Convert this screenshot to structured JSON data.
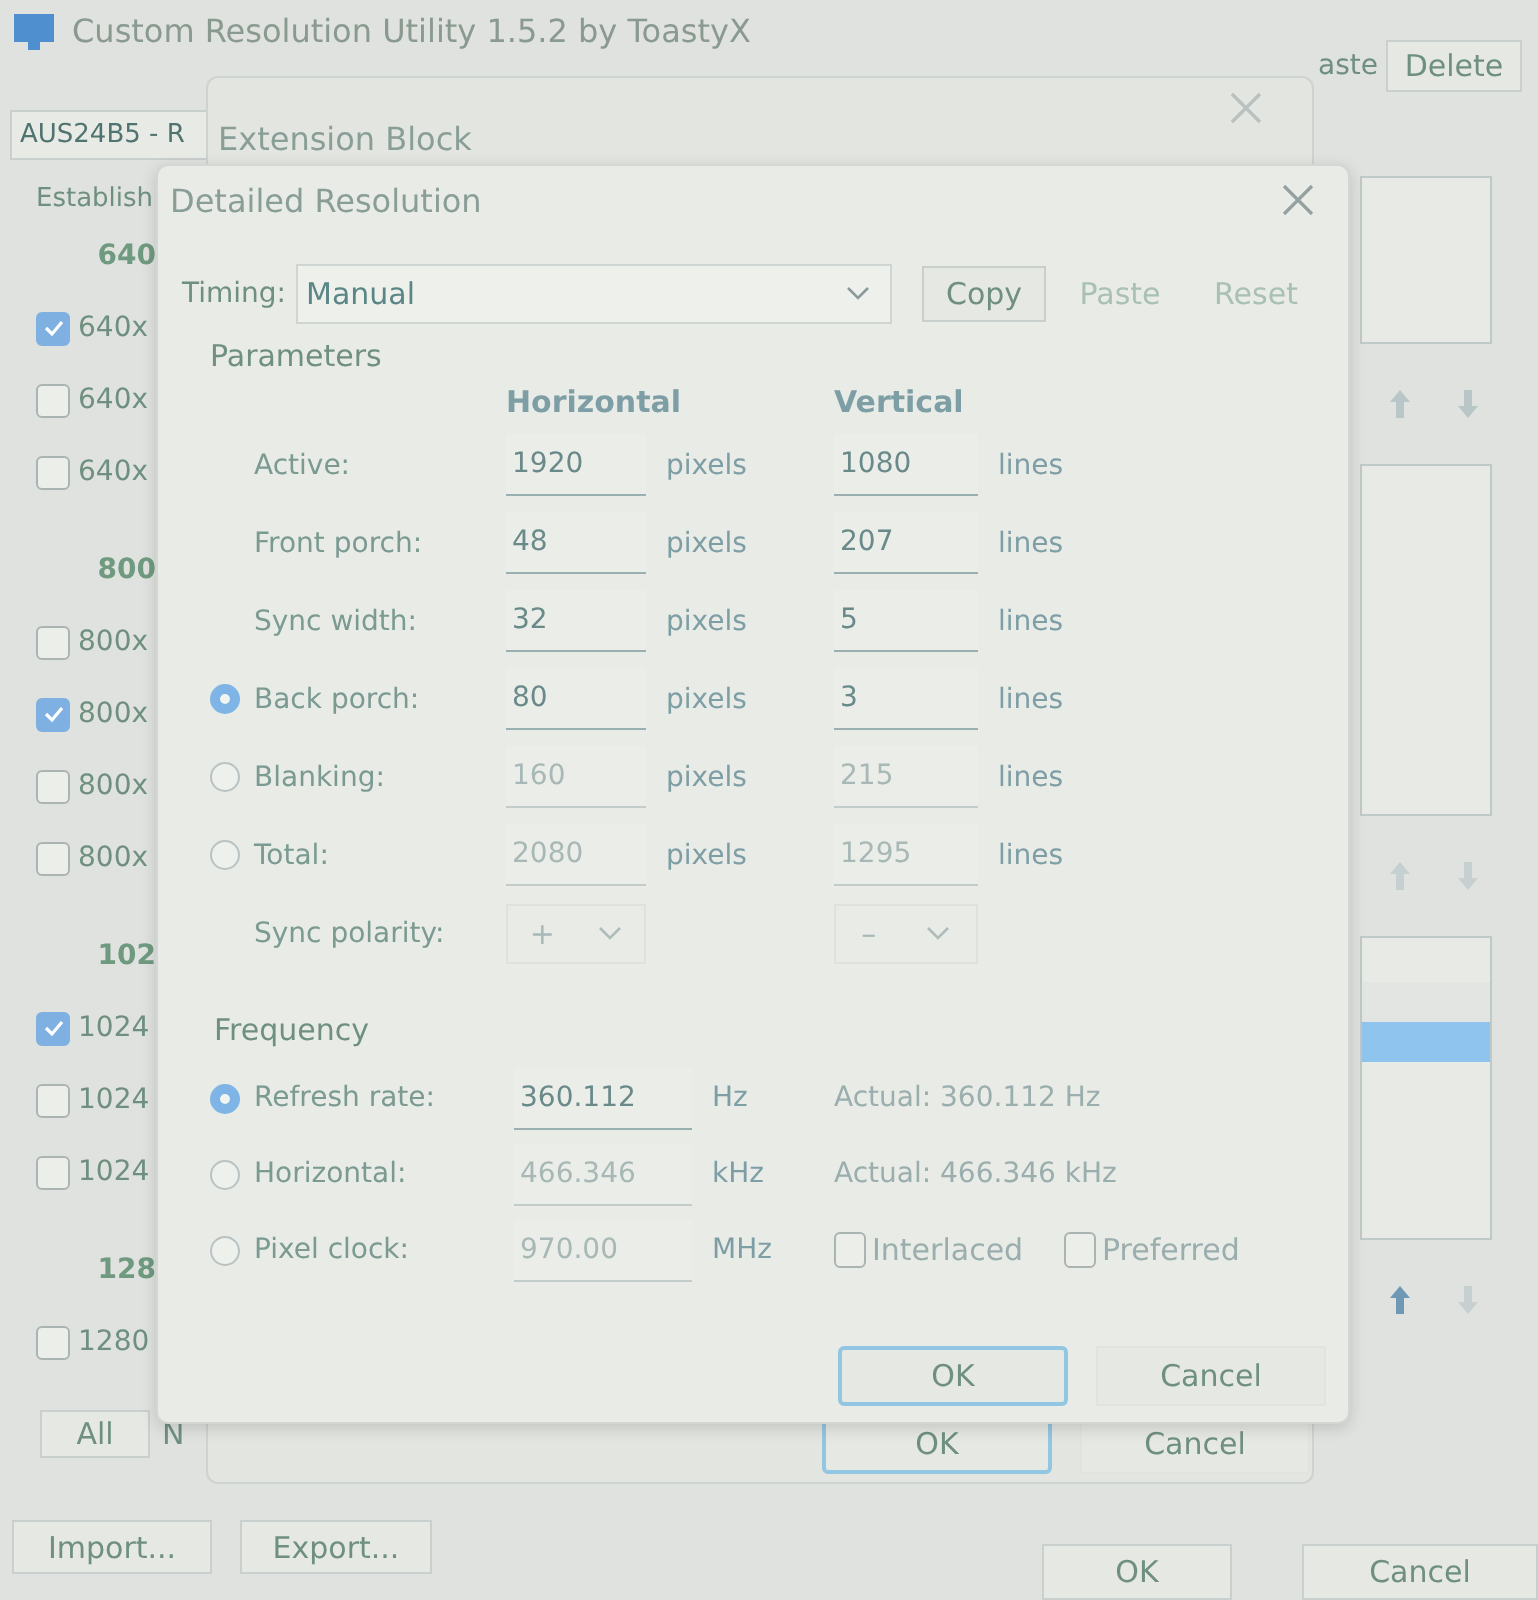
{
  "main_window": {
    "title": "Custom Resolution Utility 1.5.2 by ToastyX",
    "monitor_select": "AUS24B5 - R",
    "top_buttons": [
      "aste",
      "Delete"
    ],
    "established": {
      "label": "Establish",
      "groups": [
        {
          "header": "640",
          "items": [
            {
              "label": "640x",
              "checked": true
            },
            {
              "label": "640x",
              "checked": false
            },
            {
              "label": "640x",
              "checked": false
            }
          ]
        },
        {
          "header": "800",
          "items": [
            {
              "label": "800x",
              "checked": false
            },
            {
              "label": "800x",
              "checked": true
            },
            {
              "label": "800x",
              "checked": false
            },
            {
              "label": "800x",
              "checked": false
            }
          ]
        },
        {
          "header": "102",
          "items": [
            {
              "label": "1024",
              "checked": true
            },
            {
              "label": "1024",
              "checked": false
            },
            {
              "label": "1024",
              "checked": false
            }
          ]
        },
        {
          "header": "128",
          "items": [
            {
              "label": "1280",
              "checked": false
            }
          ]
        }
      ],
      "buttons": [
        "All",
        "N"
      ]
    },
    "lower_list": {
      "rows": [
        {
          "selected": false
        },
        {
          "selected": true
        }
      ]
    },
    "file_buttons": [
      "Import...",
      "Export..."
    ],
    "dialog_buttons": [
      "OK",
      "Cancel"
    ]
  },
  "extension_dialog": {
    "title": "Extension Block",
    "buttons": [
      {
        "label": "OK",
        "default": true
      },
      {
        "label": "Cancel",
        "default": false
      }
    ]
  },
  "detailed_dialog": {
    "title": "Detailed Resolution",
    "timing_label": "Timing:",
    "timing": "Manual",
    "timing_buttons": [
      {
        "label": "Copy",
        "disabled": false
      },
      {
        "label": "Paste",
        "disabled": true
      },
      {
        "label": "Reset",
        "disabled": true
      }
    ],
    "parameters": {
      "title": "Parameters",
      "headers": [
        "Horizontal",
        "Vertical"
      ],
      "rows": [
        {
          "kind": "plain",
          "label": "Active:",
          "h": "1920",
          "h_unit": "pixels",
          "v": "1080",
          "v_unit": "lines",
          "disabled": false
        },
        {
          "kind": "plain",
          "label": "Front porch:",
          "h": "48",
          "h_unit": "pixels",
          "v": "207",
          "v_unit": "lines",
          "disabled": false
        },
        {
          "kind": "plain",
          "label": "Sync width:",
          "h": "32",
          "h_unit": "pixels",
          "v": "5",
          "v_unit": "lines",
          "disabled": false
        },
        {
          "kind": "radio",
          "selected": true,
          "label": "Back porch:",
          "h": "80",
          "h_unit": "pixels",
          "v": "3",
          "v_unit": "lines",
          "disabled": false
        },
        {
          "kind": "radio",
          "selected": false,
          "label": "Blanking:",
          "h": "160",
          "h_unit": "pixels",
          "v": "215",
          "v_unit": "lines",
          "disabled": true
        },
        {
          "kind": "radio",
          "selected": false,
          "label": "Total:",
          "h": "2080",
          "h_unit": "pixels",
          "v": "1295",
          "v_unit": "lines",
          "disabled": true
        }
      ],
      "sync_polarity": {
        "label": "Sync polarity:",
        "h": "+",
        "v": "–"
      }
    },
    "frequency": {
      "title": "Frequency",
      "rows": [
        {
          "label": "Refresh rate:",
          "selected": true,
          "value": "360.112",
          "unit": "Hz",
          "actual": "Actual: 360.112 Hz",
          "disabled": false
        },
        {
          "label": "Horizontal:",
          "selected": false,
          "value": "466.346",
          "unit": "kHz",
          "actual": "Actual: 466.346 kHz",
          "disabled": true
        },
        {
          "label": "Pixel clock:",
          "selected": false,
          "value": "970.00",
          "unit": "MHz",
          "disabled": true
        }
      ],
      "checkboxes": [
        {
          "label": "Interlaced",
          "checked": false
        },
        {
          "label": "Preferred",
          "checked": false
        }
      ]
    },
    "buttons": [
      {
        "label": "OK",
        "default": true
      },
      {
        "label": "Cancel",
        "default": false
      }
    ]
  }
}
